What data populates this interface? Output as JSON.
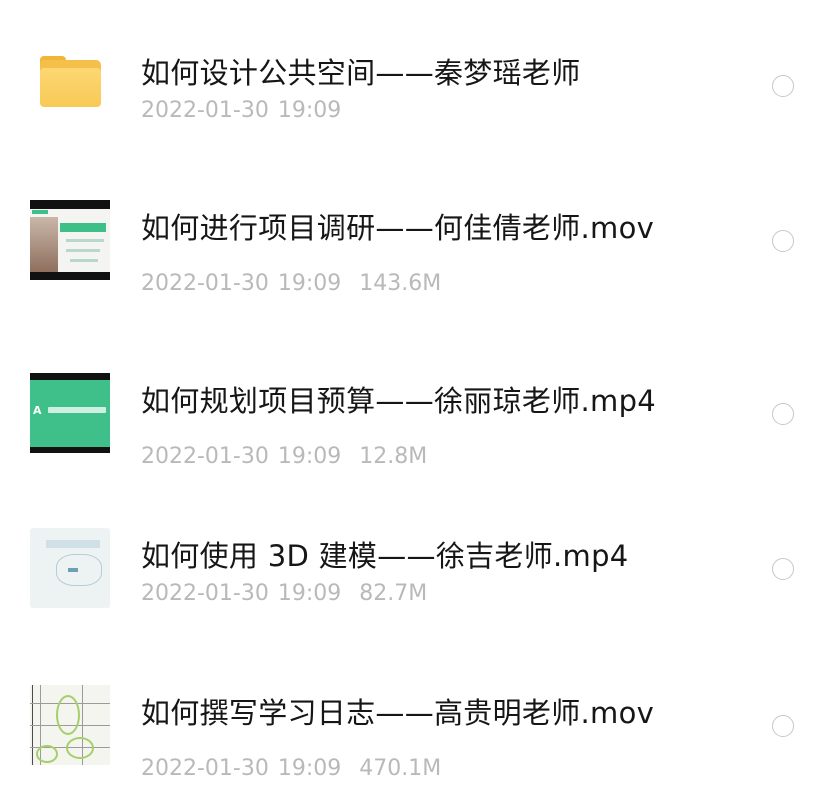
{
  "files": [
    {
      "type": "folder",
      "name": "如何设计公共空间——秦梦瑶老师",
      "date": "2022-01-30 19:09",
      "size": "",
      "icon": "folder-icon",
      "selected": false
    },
    {
      "type": "video",
      "name": "如何进行项目调研——何佳倩老师.mov",
      "date": "2022-01-30 19:09",
      "size": "143.6M",
      "icon": "video-thumbnail",
      "selected": false
    },
    {
      "type": "video",
      "name": "如何规划项目预算——徐丽琼老师.mp4",
      "date": "2022-01-30 19:09",
      "size": "12.8M",
      "icon": "video-thumbnail",
      "thumb_text": "A",
      "selected": false
    },
    {
      "type": "video",
      "name": "如何使用 3D 建模——徐吉老师.mp4",
      "date": "2022-01-30 19:09",
      "size": "82.7M",
      "icon": "video-thumbnail",
      "selected": false
    },
    {
      "type": "video",
      "name": "如何撰写学习日志——高贵明老师.mov",
      "date": "2022-01-30 19:09",
      "size": "470.1M",
      "icon": "video-thumbnail",
      "selected": false
    }
  ],
  "colors": {
    "name_text": "#161616",
    "meta_text": "#b9b9b9",
    "radio_border": "#c7c7c7",
    "folder": "#f5c04a",
    "thumb_green": "#3fc08b"
  }
}
